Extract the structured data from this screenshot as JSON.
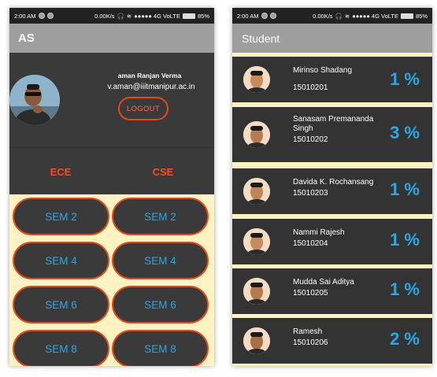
{
  "status_left": {
    "time": "2:00 AM",
    "speed": "0.00K/s"
  },
  "status_right": {
    "network": "●●●●● 4G VoLTE",
    "battery": "85%"
  },
  "left_screen": {
    "app_title": "AS",
    "profile": {
      "name": "aman Ranjan Verma",
      "email": "v.aman@iiitmanipur.ac.in",
      "logout_label": "LOGOUT"
    },
    "branches": [
      "ECE",
      "CSE"
    ],
    "semesters": [
      [
        "SEM 2",
        "SEM 2"
      ],
      [
        "SEM 4",
        "SEM 4"
      ],
      [
        "SEM 6",
        "SEM 6"
      ],
      [
        "SEM 8",
        "SEM 8"
      ]
    ]
  },
  "right_screen": {
    "app_title": "Student",
    "students": [
      {
        "name": "Mirinso Shadang",
        "roll": "15010201",
        "percent": "1 %"
      },
      {
        "name": "Sanasam Premananda Singh",
        "roll": "15010202",
        "percent": "3 %"
      },
      {
        "name": "Davida K. Rochansang",
        "roll": "15010203",
        "percent": "1 %"
      },
      {
        "name": "Nammi Rajesh",
        "roll": "15010204",
        "percent": "1 %"
      },
      {
        "name": "Mudda Sai Aditya",
        "roll": "15010205",
        "percent": "1 %"
      },
      {
        "name": "Ramesh",
        "roll": "15010206",
        "percent": "2 %"
      }
    ]
  },
  "colors": {
    "accent_orange": "#e64a19",
    "accent_blue": "#29a8e8",
    "card_bg": "#333333",
    "cream": "#fff3c4"
  }
}
